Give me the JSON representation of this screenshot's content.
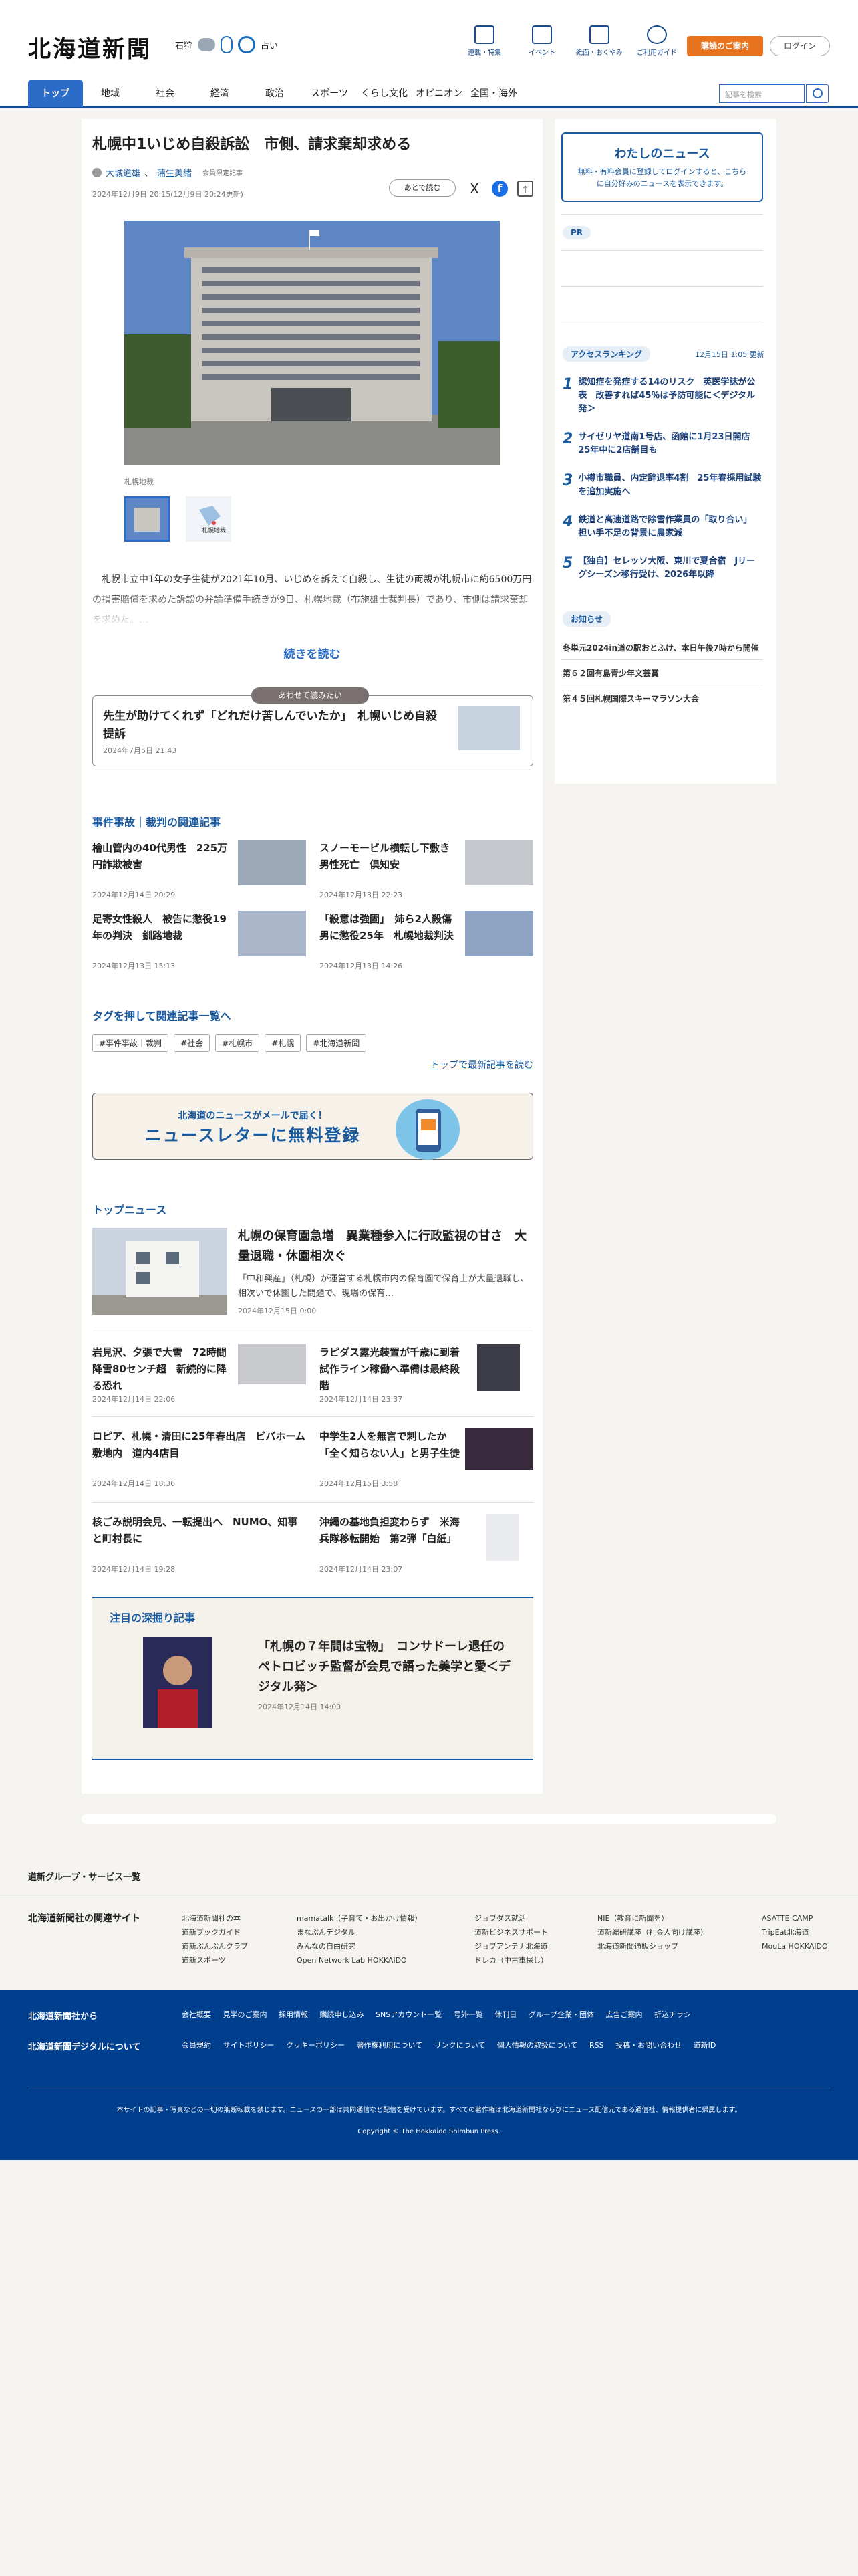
{
  "header": {
    "logo": "北海道新聞",
    "region": "石狩",
    "weather": "☁ 8 ◍",
    "weather_extra": "占い",
    "links": [
      {
        "label": "連載・特集"
      },
      {
        "label": "イベント"
      },
      {
        "label": "紙面・おくやみ"
      },
      {
        "label": "ご利用ガイド"
      }
    ],
    "subscribe": "購読のご案内",
    "login": "ログイン"
  },
  "nav": {
    "items": [
      "トップ",
      "地域",
      "社会",
      "経済",
      "政治",
      "スポーツ",
      "くらし文化",
      "オピニオン",
      "全国・海外"
    ],
    "search_placeholder": "記事を検索"
  },
  "article": {
    "title": "札幌中1いじめ自殺訴訟　市側、請求棄却求める",
    "author1": "大城道雄",
    "author2": "蒲生美緒",
    "lock": "会員限定記事",
    "date": "2024年12月9日 20:15(12月9日 20:24更新)",
    "later": "あとで読む",
    "share_x": "X",
    "share_fb": "f",
    "caption": "札幌地裁",
    "thumb2": "札幌地裁",
    "body": "　札幌市立中1年の女子生徒が2021年10月、いじめを訴えて自殺し、生徒の両親が札幌市に約6500万円の損害賠償を求めた訴訟の弁論準備手続きが9日、札幌地裁（布施雄士裁判長）であり、市側は請求棄却を求めた。…",
    "readmore": "続きを読む"
  },
  "also_read": {
    "tag": "あわせて読みたい",
    "title": "先生が助けてくれず「どれだけ苦しんでいたか」　札幌いじめ自殺提訴",
    "date": "2024年7月5日 21:43"
  },
  "related": {
    "heading": "事件事故｜裁判の関連記事",
    "items": [
      {
        "title": "檜山管内の40代男性　225万円詐欺被害",
        "date": "2024年12月14日 20:29"
      },
      {
        "title": "スノーモービル横転し下敷き　男性死亡　倶知安",
        "date": "2024年12月13日 22:23"
      },
      {
        "title": "足寄女性殺人　被告に懲役19年の判決　釧路地裁",
        "date": "2024年12月13日 15:13"
      },
      {
        "title": "「殺意は強固」　姉ら2人殺傷　男に懲役25年　札幌地裁判決",
        "date": "2024年12月13日 14:26"
      }
    ]
  },
  "tags": {
    "heading": "タグを押して関連記事一覧へ",
    "items": [
      "#事件事故｜裁判",
      "#社会",
      "#札幌市",
      "#札幌",
      "#北海道新聞"
    ],
    "latest": "トップで最新記事を読む"
  },
  "newsletter": {
    "sub": "北海道のニュースがメールで届く！",
    "main": "ニュースレターに無料登録"
  },
  "topnews": {
    "heading": "トップニュース",
    "lead": {
      "title": "札幌の保育園急増　異業種参入に行政監視の甘さ　大量退職・休園相次ぐ",
      "summary": "「中和興産」（札幌）が運営する札幌市内の保育園で保育士が大量退職し、相次いで休園した問題で、現場の保育…",
      "date": "2024年12月15日 0:00"
    },
    "items": [
      {
        "title": "岩見沢、夕張で大雪　72時間降雪80センチ超　新続的に降る恐れ",
        "date": "2024年12月14日 22:06"
      },
      {
        "title": "ラピダス露光装置が千歳に到着　試作ライン稼働へ準備は最終段階",
        "date": "2024年12月14日 23:37"
      },
      {
        "title": "ロピア、札幌・清田に25年春出店　ビバホーム敷地内　道内4店目",
        "date": "2024年12月14日 18:36"
      },
      {
        "title": "中学生2人を無言で刺したか　「全く知らない人」と男子生徒",
        "date": "2024年12月15日 3:58"
      },
      {
        "title": "核ごみ説明会見、一転提出へ　NUMO、知事と町村長に",
        "date": "2024年12月14日 19:28"
      },
      {
        "title": "沖縄の基地負担変わらず　米海兵隊移転開始　第2弾「白紙」",
        "date": "2024年12月14日 23:07"
      }
    ]
  },
  "deep_dive": {
    "heading": "注目の深掘り記事",
    "title": "「札幌の７年間は宝物」　コンサドーレ退任のペトロビッチ監督が会見で語った美学と愛＜デジタル発＞",
    "date": "2024年12月14日 14:00"
  },
  "sidebar": {
    "mynews_title": "わたしのニュース",
    "mynews_text": "無料・有料会員に登録してログインすると、こちらに自分好みのニュースを表示できます。",
    "pr": "PR",
    "ranking_head": "アクセスランキング",
    "ranking_date": "12月15日 1:05 更新",
    "ranking": [
      {
        "n": "1",
        "title": "認知症を発症する14のリスク　英医学誌が公表　改善すれば45％は予防可能に＜デジタル発＞"
      },
      {
        "n": "2",
        "title": "サイゼリヤ道南1号店、函館に1月23日開店　25年中に2店舗目も"
      },
      {
        "n": "3",
        "title": "小樽市職員、内定辞退率4割　25年春採用試験を追加実施へ"
      },
      {
        "n": "4",
        "title": "鉄道と高速道路で除雪作業員の「取り合い」　担い手不足の背景に農家減"
      },
      {
        "n": "5",
        "title": "【独自】セレッソ大阪、東川で夏合宿　Jリーグシーズン移行受け、2026年以降"
      }
    ],
    "notice_head": "お知らせ",
    "notices": [
      "冬単元2024in道の駅おとふけ、本日午後7時から開催",
      "第６２回有島青少年文芸賞",
      "第４５回札幌国際スキーマラソン大会"
    ]
  },
  "footer": {
    "group": "道新グループ・サービス一覧",
    "related_head": "北海道新聞社の関連サイト",
    "col1": [
      "北海道新聞社の本",
      "道新ブックガイド",
      "道新ぶんぶんクラブ",
      "道新スポーツ"
    ],
    "col2": [
      "mamatalk（子育て・お出かけ情報）",
      "まなぶんデジタル",
      "みんなの自由研究",
      "Open Network Lab HOKKAIDO"
    ],
    "col3": [
      "ジョブダス就活",
      "道新ビジネスサポート",
      "ジョブアンテナ北海道",
      "ドレカ（中古車探し）"
    ],
    "col4": [
      "NIE（教育に新聞を）",
      "道新総研講座（社会人向け講座）",
      "北海道新聞通販ショップ"
    ],
    "col5": [
      "ASATTE CAMP",
      "TripEat北海道",
      "MouLa HOKKAIDO"
    ],
    "about_head": "北海道新聞社から",
    "digital_head": "北海道新聞デジタルについて",
    "about_links": [
      "会社概要",
      "見学のご案内",
      "採用情報",
      "購読申し込み",
      "SNSアカウント一覧",
      "号外一覧",
      "休刊日",
      "グループ企業・団体",
      "広告ご案内",
      "折込チラシ"
    ],
    "digital_links": [
      "会員規約",
      "サイトポリシー",
      "クッキーポリシー",
      "著作権利用について",
      "リンクについて",
      "個人情報の取扱について",
      "RSS",
      "投稿・お問い合わせ",
      "道新ID"
    ],
    "note": "本サイトの記事・写真などの一切の無断転載を禁じます。ニュースの一部は共同通信など配信を受けています。すべての著作権は北海道新聞社ならびにニュース配信元である通信社、情報提供者に帰属します。",
    "copyright": "Copyright © The Hokkaido Shimbun Press."
  },
  "colors": {
    "accent": "#1a5ba0",
    "nav_active": "#2a6cc8",
    "orange": "#e8731e",
    "footer": "#003f8e"
  }
}
